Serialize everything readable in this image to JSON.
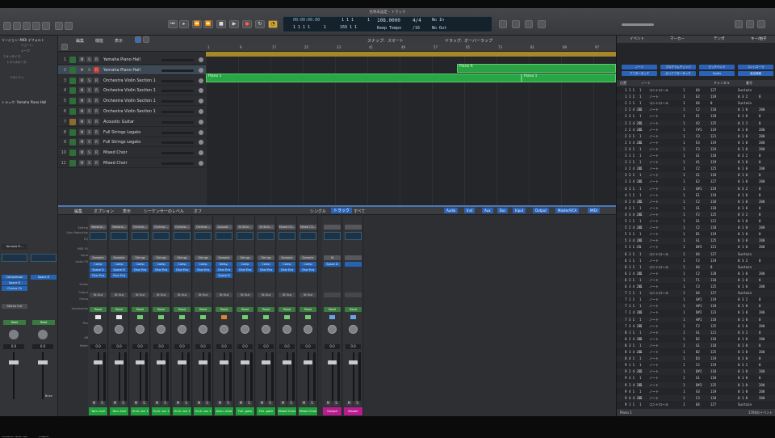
{
  "window": {
    "title": "名称未設定 - トラック",
    "zoom_label": ""
  },
  "transport": {
    "position_time": "00:00:00.00",
    "position_bars": "1 1 1",
    "sub": "1",
    "bars2": "1 1 1 1",
    "sub2": "1",
    "bar_end": "169 1 1",
    "tempo": "108.0000",
    "tempo_mode": "Keep Tempo",
    "sig": "4/4",
    "division": "/16",
    "in_label": "No In",
    "out_label": "No Out"
  },
  "tracks_header": {
    "menu_edit": "編集",
    "menu_func": "機能",
    "menu_view": "表示",
    "snap": "スナップ:",
    "snap_val": "スマート",
    "drag": "ドラッグ:",
    "drag_val": "オーバーラップ"
  },
  "inspector": {
    "region_label": "リージョン: MIDI デフォルト",
    "track_label": "トラック: Yamaha Piano Hall",
    "r1": "ミュート:",
    "r2": "ループ:",
    "r3": "クオンタイズ:",
    "r4": "トランスポーズ:",
    "r5": "ベロシティ:",
    "ch_name1": "Yamaha Pi...",
    "ch_name2": "Output",
    "fx1": "Compressor",
    "fx2": "Space D",
    "fx3": "Chorus Ch",
    "send": "Space D",
    "out": "Stereo Out",
    "read": "Read",
    "val1": "0.0",
    "val2": "0.0",
    "bot1": "Yamaha Piano Hall",
    "bot2": "Output",
    "bnc": "Bnce"
  },
  "tracks": [
    {
      "num": "1",
      "name": "Yamaha Piano Hall",
      "color": "#2f6d3b"
    },
    {
      "num": "2",
      "name": "Yamaha Piano Hall",
      "color": "#2f6d3b"
    },
    {
      "num": "3",
      "name": "Orchestra Violin Section 1",
      "color": "#2f6d3b"
    },
    {
      "num": "4",
      "name": "Orchestra Violin Section 1",
      "color": "#2f6d3b"
    },
    {
      "num": "5",
      "name": "Orchestra Violin Section 1",
      "color": "#2f6d3b"
    },
    {
      "num": "6",
      "name": "Orchestra Violin Section 1",
      "color": "#2f6d3b"
    },
    {
      "num": "7",
      "name": "Acoustic Guitar",
      "color": "#8a6d2e"
    },
    {
      "num": "8",
      "name": "Full Strings Legato",
      "color": "#2f6d3b"
    },
    {
      "num": "9",
      "name": "Full Strings Legato",
      "color": "#2f6d3b"
    },
    {
      "num": "10",
      "name": "Mixed Choir",
      "color": "#2f6d3b"
    },
    {
      "num": "11",
      "name": "Mixed Choir",
      "color": "#2f6d3b"
    }
  ],
  "regions": [
    {
      "label": "Piano R"
    },
    {
      "label": "Piano 1"
    },
    {
      "label": "Piano 1"
    }
  ],
  "ruler": [
    "1",
    "9",
    "17",
    "25",
    "33",
    "41",
    "49",
    "57",
    "65",
    "73",
    "81",
    "89",
    "97"
  ],
  "mixer": {
    "menu1": "編集",
    "menu2": "オプション",
    "menu3": "表示",
    "menu4": "シーケンサーのレベル",
    "menu5": "オフ",
    "mode1": "シングル",
    "mode2": "トラック",
    "mode3": "すべて",
    "filters": [
      "Audio",
      "Inst",
      "Aux",
      "Bus",
      "Input",
      "Output",
      "Master/VCA",
      "MIDI"
    ],
    "row_labels": [
      "Setting",
      "Gain Reduction",
      "EQ",
      "MIDI FX",
      "Input",
      "Audio FX",
      "Sends",
      "Output",
      "Group",
      "Automation",
      "Pan",
      "dB",
      "Meter"
    ],
    "channels": [
      {
        "setting": "Yamaha...",
        "input": "Sampler",
        "fx": "Comp",
        "fx2": "Space D",
        "fx3": "Chor Ens",
        "out": "St Out",
        "auto": "Read",
        "db": "0.0",
        "name": "Yam..hall",
        "color": "#20a13b",
        "pan": "a"
      },
      {
        "setting": "Yamaha...",
        "input": "Sampler",
        "fx": "Comp",
        "fx2": "Space D",
        "fx3": "Chor Ens",
        "out": "St Out",
        "auto": "Read",
        "db": "0.0",
        "name": "Yam..hall",
        "color": "#20a13b",
        "pan": "a"
      },
      {
        "setting": "Orchest...",
        "input": "Strings",
        "fx": "Comp",
        "fx2": "Chor Ens",
        "fx3": "",
        "out": "St Out",
        "auto": "Read",
        "db": "0.0",
        "name": "Orch..ion 1",
        "color": "#20a13b",
        "pan": "b"
      },
      {
        "setting": "Orchest...",
        "input": "Strings",
        "fx": "Comp",
        "fx2": "Chor Ens",
        "fx3": "",
        "out": "St Out",
        "auto": "Read",
        "db": "0.0",
        "name": "Orch..ion 1",
        "color": "#20a13b",
        "pan": "b"
      },
      {
        "setting": "Orchest...",
        "input": "Strings",
        "fx": "Comp",
        "fx2": "Chor Ens",
        "fx3": "",
        "out": "St Out",
        "auto": "Read",
        "db": "0.0",
        "name": "Orch..ion 1",
        "color": "#20a13b",
        "pan": "b"
      },
      {
        "setting": "Orchest...",
        "input": "Strings",
        "fx": "Comp",
        "fx2": "Chor Ens",
        "fx3": "",
        "out": "St Out",
        "auto": "Read",
        "db": "0.0",
        "name": "Orch..ion 1",
        "color": "#20a13b",
        "pan": "b"
      },
      {
        "setting": "Acousti...",
        "input": "Sampler",
        "fx": "Delay..",
        "fx2": "Chor Ens",
        "fx3": "Space D",
        "out": "St Out",
        "auto": "Read",
        "db": "0.0",
        "name": "Acou..uitar",
        "color": "#20a13b",
        "pan": "o"
      },
      {
        "setting": "St Strin...",
        "input": "Strings",
        "fx": "Comp",
        "fx2": "Chor Ens",
        "fx3": "",
        "out": "St Out",
        "auto": "Read",
        "db": "0.0",
        "name": "Full..gato",
        "color": "#20a13b",
        "pan": "b"
      },
      {
        "setting": "St Strin...",
        "input": "Strings",
        "fx": "Comp",
        "fx2": "Chor Ens",
        "fx3": "",
        "out": "St Out",
        "auto": "Read",
        "db": "0.0",
        "name": "Full..gato",
        "color": "#20a13b",
        "pan": "b"
      },
      {
        "setting": "Mixed Ch...",
        "input": "Sampler",
        "fx": "Comp",
        "fx2": "Chor Ens",
        "fx3": "",
        "out": "St Out",
        "auto": "Read",
        "db": "0.0",
        "name": "Mixed Choir",
        "color": "#20a13b",
        "pan": "b"
      },
      {
        "setting": "Mixed Ch...",
        "input": "Sampler",
        "fx": "Comp",
        "fx2": "Chor Ens",
        "fx3": "",
        "out": "St Out",
        "auto": "Read",
        "db": "0.0",
        "name": "Mixed Choir",
        "color": "#20a13b",
        "pan": "b"
      },
      {
        "setting": "",
        "input": "St",
        "fx": "Space D",
        "fx2": "",
        "fx3": "",
        "out": "",
        "auto": "Read",
        "db": "0.0",
        "name": "Output",
        "color": "#b81d8f",
        "pan": "n"
      },
      {
        "setting": "",
        "input": "",
        "fx": "",
        "fx2": "",
        "fx3": "",
        "out": "",
        "auto": "Read",
        "db": "0.0",
        "name": "Master",
        "color": "#b81d8f",
        "pan": "n"
      }
    ]
  },
  "events": {
    "tabs": [
      "イベント",
      "マーカー",
      "テンポ",
      "キー/拍子"
    ],
    "buttons": [
      "ノート",
      "プログラムチェンジ",
      "ピッチベンド",
      "コントローラ",
      "アフタータッチ",
      "ポリアフタータッチ",
      "SysEx",
      "追加情報"
    ],
    "header": [
      "位置",
      "ノート",
      "チャンネル",
      "番号",
      "ベロシティ",
      "長さ"
    ],
    "rows": [
      [
        "1 1 1",
        "1",
        "コントロール",
        "1",
        "64",
        "127",
        "Sustain"
      ],
      [
        "1 1 1",
        "1",
        "ノート",
        "1",
        "E2",
        "119",
        "0 3 2",
        "0"
      ],
      [
        "2 1 1",
        "1",
        "コントロール",
        "1",
        "64",
        "0",
        "Sustain"
      ],
      [
        "2 2 4 201",
        "1",
        "ノート",
        "1",
        "C2",
        "118",
        "0 1 0",
        "200"
      ],
      [
        "2 3 1",
        "1",
        "ノート",
        "1",
        "E1",
        "118",
        "0 1 0",
        "0"
      ],
      [
        "2 3 4 201",
        "1",
        "ノート",
        "1",
        "A2",
        "125",
        "0 3 2",
        "0"
      ],
      [
        "2 2 4 201",
        "1",
        "ノート",
        "1",
        "F#1",
        "119",
        "0 1 0",
        "200"
      ],
      [
        "2 3 1",
        "1",
        "ノート",
        "1",
        "C3",
        "121",
        "0 1 0",
        "200"
      ],
      [
        "2 3 4 201",
        "1",
        "ノート",
        "1",
        "E3",
        "119",
        "0 1 0",
        "200"
      ],
      [
        "2 4 1",
        "1",
        "ノート",
        "1",
        "F3",
        "124",
        "0 1 0",
        "200"
      ],
      [
        "3 1 1",
        "1",
        "ノート",
        "1",
        "G1",
        "118",
        "0 3 2",
        "0"
      ],
      [
        "3 1 1",
        "1",
        "ノート",
        "1",
        "A1",
        "119",
        "0 1 0",
        "0"
      ],
      [
        "3 2 4 201",
        "1",
        "ノート",
        "1",
        "C2",
        "125",
        "0 1 0",
        "200"
      ],
      [
        "3 3 1",
        "1",
        "ノート",
        "1",
        "G1",
        "118",
        "0 1 0",
        "0"
      ],
      [
        "3 3 4 201",
        "1",
        "ノート",
        "1",
        "E2",
        "127",
        "0 1 0",
        "200"
      ],
      [
        "4 1 1",
        "1",
        "ノート",
        "1",
        "G#1",
        "119",
        "0 3 2",
        "0"
      ],
      [
        "4 1 1",
        "1",
        "ノート",
        "1",
        "E1",
        "119",
        "0 1 0",
        "0"
      ],
      [
        "4 2 4 201",
        "1",
        "ノート",
        "1",
        "C2",
        "118",
        "0 1 0",
        "200"
      ],
      [
        "4 3 1",
        "1",
        "ノート",
        "1",
        "G1",
        "118",
        "0 1 0",
        "0"
      ],
      [
        "4 3 4 201",
        "1",
        "ノート",
        "1",
        "F2",
        "125",
        "0 3 2",
        "0"
      ],
      [
        "5 1 1",
        "1",
        "ノート",
        "1",
        "G1",
        "121",
        "0 1 0",
        "0"
      ],
      [
        "5 2 4 201",
        "1",
        "ノート",
        "1",
        "C2",
        "118",
        "0 1 0",
        "200"
      ],
      [
        "5 3 1",
        "1",
        "ノート",
        "1",
        "D1",
        "119",
        "0 1 0",
        "0"
      ],
      [
        "5 3 4 201",
        "1",
        "ノート",
        "1",
        "G1",
        "125",
        "0 1 0",
        "200"
      ],
      [
        "5 3 1 41",
        "1",
        "ノート",
        "1",
        "D#3",
        "121",
        "0 1 0",
        "200"
      ],
      [
        "6 1 1",
        "1",
        "コントロール",
        "1",
        "64",
        "127",
        "Sustain"
      ],
      [
        "6 1 1",
        "1",
        "ノート",
        "1",
        "F2",
        "119",
        "0 3 2",
        "0"
      ],
      [
        "6 1 1",
        "1",
        "コントロール",
        "1",
        "64",
        "0",
        "Sustain"
      ],
      [
        "6 2 4 201",
        "1",
        "ノート",
        "1",
        "C2",
        "120",
        "0 1 0",
        "200"
      ],
      [
        "6 3 1",
        "1",
        "ノート",
        "1",
        "F1",
        "118",
        "0 1 0",
        "0"
      ],
      [
        "6 3 4 201",
        "1",
        "ノート",
        "1",
        "C3",
        "125",
        "0 1 0",
        "200"
      ],
      [
        "7 1 1",
        "1",
        "コントロール",
        "1",
        "64",
        "127",
        "Sustain"
      ],
      [
        "7 1 1",
        "1",
        "ノート",
        "1",
        "G#1",
        "119",
        "0 3 2",
        "0"
      ],
      [
        "7 1 1",
        "1",
        "ノート",
        "1",
        "A#1",
        "118",
        "0 1 0",
        "0"
      ],
      [
        "7 2 4 201",
        "1",
        "ノート",
        "1",
        "D#2",
        "123",
        "0 1 0",
        "200"
      ],
      [
        "7 3 1",
        "1",
        "ノート",
        "1",
        "A#1",
        "118",
        "0 1 0",
        "0"
      ],
      [
        "7 3 4 201",
        "1",
        "ノート",
        "1",
        "F2",
        "125",
        "0 1 0",
        "200"
      ],
      [
        "8 1 1",
        "1",
        "ノート",
        "1",
        "G1",
        "121",
        "0 3 2",
        "0"
      ],
      [
        "8 2 4 201",
        "1",
        "ノート",
        "1",
        "D2",
        "118",
        "0 1 0",
        "200"
      ],
      [
        "8 3 1",
        "1",
        "ノート",
        "1",
        "G1",
        "118",
        "0 1 0",
        "0"
      ],
      [
        "8 3 4 201",
        "1",
        "ノート",
        "1",
        "B2",
        "125",
        "0 1 0",
        "200"
      ],
      [
        "8 4 1",
        "1",
        "ノート",
        "1",
        "D3",
        "119",
        "0 1 0",
        "0"
      ],
      [
        "9 1 1",
        "1",
        "ノート",
        "1",
        "C2",
        "119",
        "0 3 2",
        "0"
      ],
      [
        "9 2 4 201",
        "1",
        "ノート",
        "1",
        "D#2",
        "118",
        "0 1 0",
        "200"
      ],
      [
        "9 3 1",
        "1",
        "ノート",
        "1",
        "G1",
        "118",
        "0 1 0",
        "0"
      ],
      [
        "9 3 4 201",
        "1",
        "ノート",
        "1",
        "D#3",
        "125",
        "0 1 0",
        "200"
      ],
      [
        "9 4 1",
        "1",
        "ノート",
        "1",
        "G3",
        "119",
        "0 1 0",
        "200"
      ],
      [
        "9 4 4 201",
        "1",
        "ノート",
        "1",
        "C3",
        "118",
        "0 1 0",
        "200"
      ],
      [
        "9 1 1",
        "1",
        "コントロール",
        "1",
        "64",
        "127",
        "Sustain"
      ]
    ],
    "footer_left": "Piano 1",
    "footer_right": "1700のイベント"
  }
}
